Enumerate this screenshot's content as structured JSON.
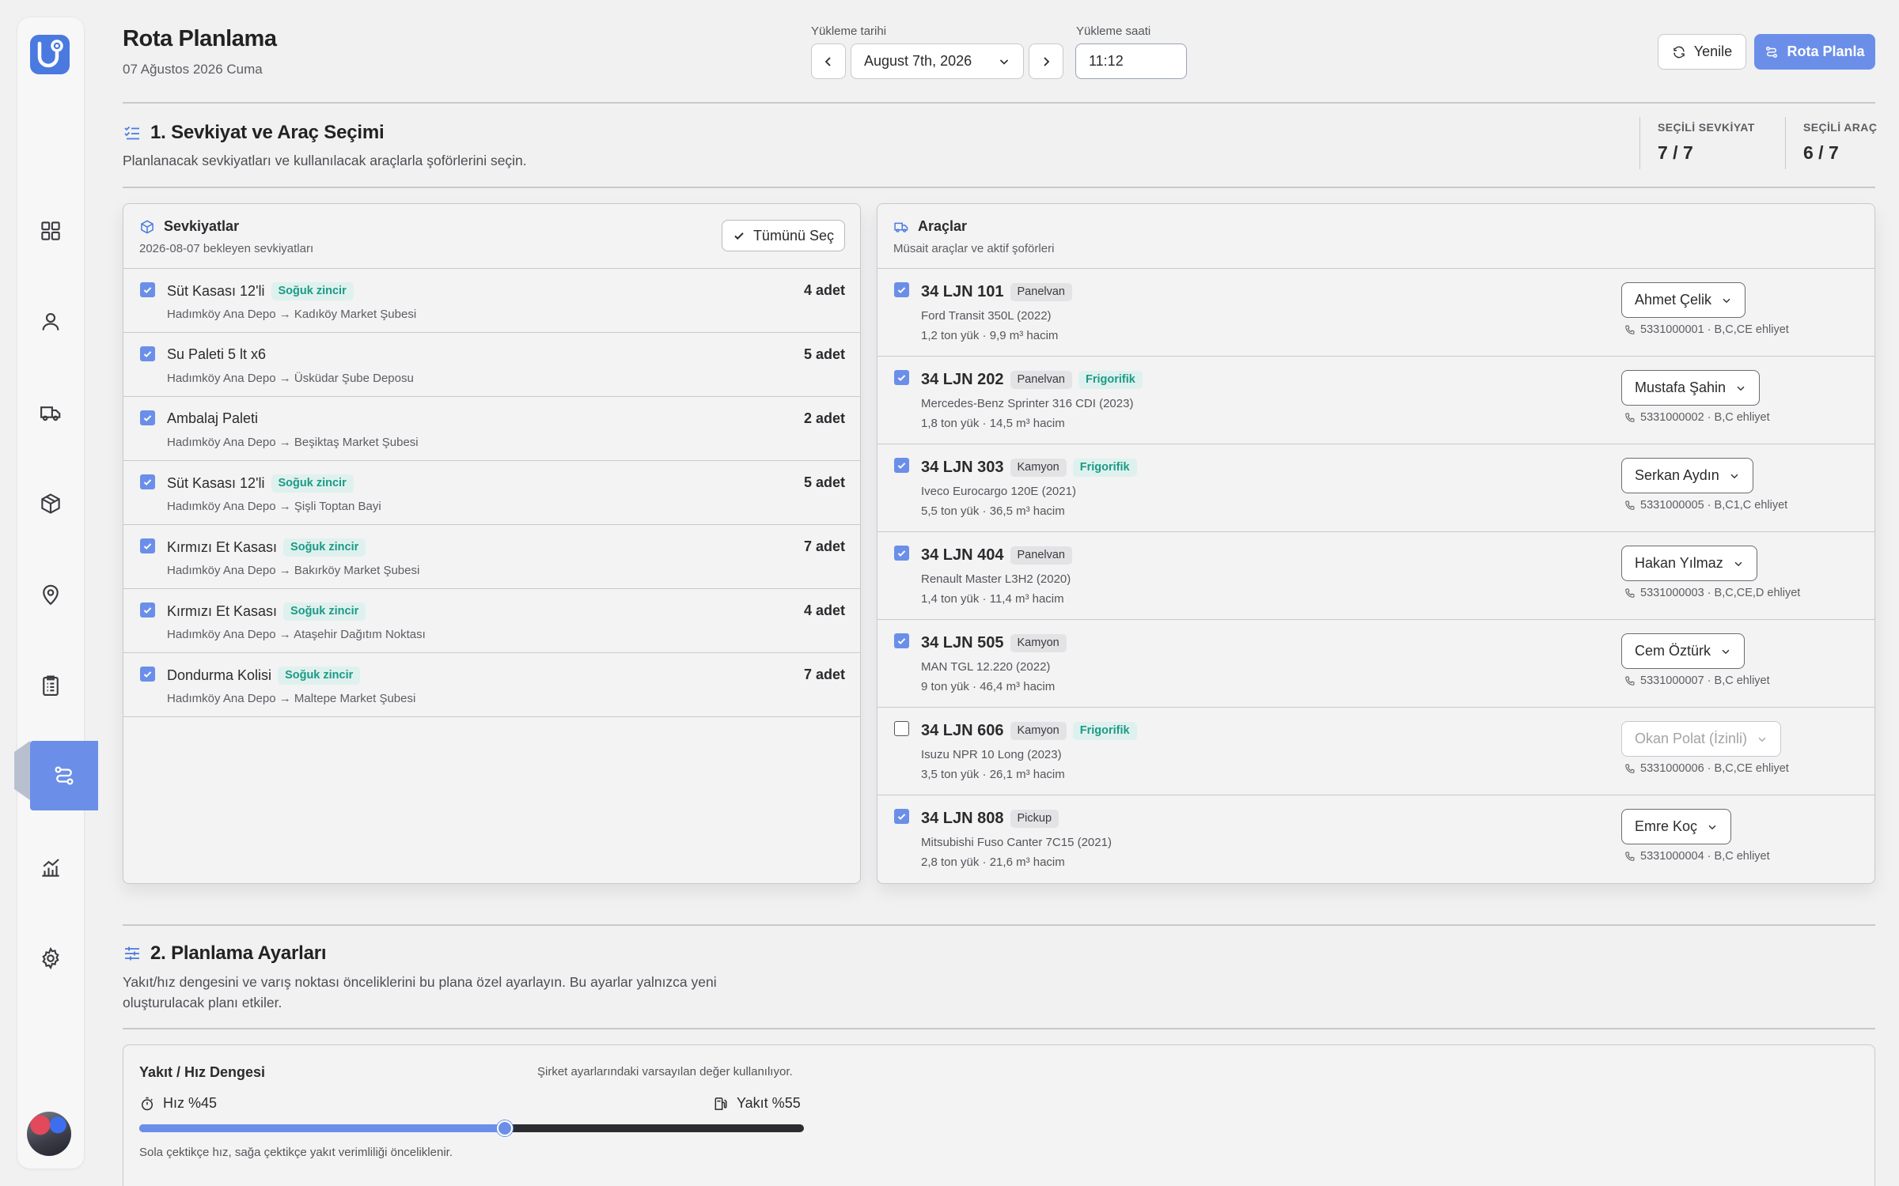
{
  "app": {
    "title": "Rota Planlama",
    "date_text": "07 Ağustos 2026 Cuma"
  },
  "header": {
    "load_date_label": "Yükleme tarihi",
    "load_date_value": "August 7th, 2026",
    "load_time_label": "Yükleme saati",
    "load_time_value": "11:12",
    "refresh_label": "Yenile",
    "plan_label": "Rota Planla"
  },
  "sidebar": {
    "items": [
      {
        "icon": "dashboard-icon"
      },
      {
        "icon": "user-icon"
      },
      {
        "icon": "truck-icon"
      },
      {
        "icon": "package-icon"
      },
      {
        "icon": "map-pin-icon"
      },
      {
        "icon": "clipboard-icon"
      },
      {
        "icon": "route-icon",
        "active": true
      },
      {
        "icon": "chart-icon"
      },
      {
        "icon": "gear-icon"
      }
    ]
  },
  "section1": {
    "title": "1. Sevkiyat ve Araç Seçimi",
    "description": "Planlanacak sevkiyatları ve kullanılacak araçlarla şoförlerini seçin.",
    "stats": [
      {
        "label": "SEÇİLİ SEVKİYAT",
        "value": "7 / 7"
      },
      {
        "label": "SEÇİLİ ARAÇ",
        "value": "6 / 7"
      }
    ]
  },
  "shipments": {
    "title": "Sevkiyatlar",
    "subtitle": "2026-08-07 bekleyen sevkiyatları",
    "select_all_label": "Tümünü Seç",
    "items": [
      {
        "name": "Süt Kasası 12'li",
        "badge": "Soğuk zincir",
        "route": "Hadımköy Ana Depo → Kadıköy Market Şubesi",
        "qty": "4 adet",
        "checked": true
      },
      {
        "name": "Su Paleti 5 lt x6",
        "badge": "",
        "route": "Hadımköy Ana Depo → Üsküdar Şube Deposu",
        "qty": "5 adet",
        "checked": true
      },
      {
        "name": "Ambalaj Paleti",
        "badge": "",
        "route": "Hadımköy Ana Depo → Beşiktaş Market Şubesi",
        "qty": "2 adet",
        "checked": true
      },
      {
        "name": "Süt Kasası 12'li",
        "badge": "Soğuk zincir",
        "route": "Hadımköy Ana Depo → Şişli Toptan Bayi",
        "qty": "5 adet",
        "checked": true
      },
      {
        "name": "Kırmızı Et Kasası",
        "badge": "Soğuk zincir",
        "route": "Hadımköy Ana Depo → Bakırköy Market Şubesi",
        "qty": "7 adet",
        "checked": true
      },
      {
        "name": "Kırmızı Et Kasası",
        "badge": "Soğuk zincir",
        "route": "Hadımköy Ana Depo → Ataşehir Dağıtım Noktası",
        "qty": "4 adet",
        "checked": true
      },
      {
        "name": "Dondurma Kolisi",
        "badge": "Soğuk zincir",
        "route": "Hadımköy Ana Depo → Maltepe Market Şubesi",
        "qty": "7 adet",
        "checked": true
      }
    ]
  },
  "vehicles": {
    "title": "Araçlar",
    "subtitle": "Müsait araçlar ve aktif şoförleri",
    "items": [
      {
        "plate": "34 LJN 101",
        "type": "Panelvan",
        "frigo": "",
        "model": "Ford Transit 350L (2022)",
        "capacity": "1,2 ton yük · 9,9 m³ hacim",
        "driver": "Ahmet Çelik",
        "phone": "5331000001 · B,C,CE ehliyet",
        "checked": true,
        "disabled": false
      },
      {
        "plate": "34 LJN 202",
        "type": "Panelvan",
        "frigo": "Frigorifik",
        "model": "Mercedes-Benz Sprinter 316 CDI (2023)",
        "capacity": "1,8 ton yük · 14,5 m³ hacim",
        "driver": "Mustafa Şahin",
        "phone": "5331000002 · B,C ehliyet",
        "checked": true,
        "disabled": false
      },
      {
        "plate": "34 LJN 303",
        "type": "Kamyon",
        "frigo": "Frigorifik",
        "model": "Iveco Eurocargo 120E (2021)",
        "capacity": "5,5 ton yük · 36,5 m³ hacim",
        "driver": "Serkan Aydın",
        "phone": "5331000005 · B,C1,C ehliyet",
        "checked": true,
        "disabled": false
      },
      {
        "plate": "34 LJN 404",
        "type": "Panelvan",
        "frigo": "",
        "model": "Renault Master L3H2 (2020)",
        "capacity": "1,4 ton yük · 11,4 m³ hacim",
        "driver": "Hakan Yılmaz",
        "phone": "5331000003 · B,C,CE,D ehliyet",
        "checked": true,
        "disabled": false
      },
      {
        "plate": "34 LJN 505",
        "type": "Kamyon",
        "frigo": "",
        "model": "MAN TGL 12.220 (2022)",
        "capacity": "9 ton yük · 46,4 m³ hacim",
        "driver": "Cem Öztürk",
        "phone": "5331000007 · B,C ehliyet",
        "checked": true,
        "disabled": false
      },
      {
        "plate": "34 LJN 606",
        "type": "Kamyon",
        "frigo": "Frigorifik",
        "model": "Isuzu NPR 10 Long (2023)",
        "capacity": "3,5 ton yük · 26,1 m³ hacim",
        "driver": "Okan Polat (İzinli)",
        "phone": "5331000006 · B,C,CE ehliyet",
        "checked": false,
        "disabled": true
      },
      {
        "plate": "34 LJN 808",
        "type": "Pickup",
        "frigo": "",
        "model": "Mitsubishi Fuso Canter 7C15 (2021)",
        "capacity": "2,8 ton yük · 21,6 m³ hacim",
        "driver": "Emre Koç",
        "phone": "5331000004 · B,C ehliyet",
        "checked": true,
        "disabled": false
      }
    ]
  },
  "section2": {
    "title": "2. Planlama Ayarları",
    "description_line1": "Yakıt/hız dengesini ve varış noktası önceliklerini bu plana özel ayarlayın. Bu ayarlar yalnızca yeni",
    "description_line2": "oluşturulacak planı etkiler."
  },
  "balance": {
    "title": "Yakıt / Hız Dengesi",
    "note": "Şirket ayarlarındaki varsayılan değer kullanılıyor.",
    "speed_label": "Hız %45",
    "fuel_label": "Yakıt %55",
    "value_percent": 55,
    "help": "Sola çektikçe hız, sağa çektikçe yakıt verimliliği önceliklenir."
  },
  "colors": {
    "accent": "#6b8fe8",
    "brand": "#4a7ae0",
    "cold_chain": "#1b9a86"
  }
}
